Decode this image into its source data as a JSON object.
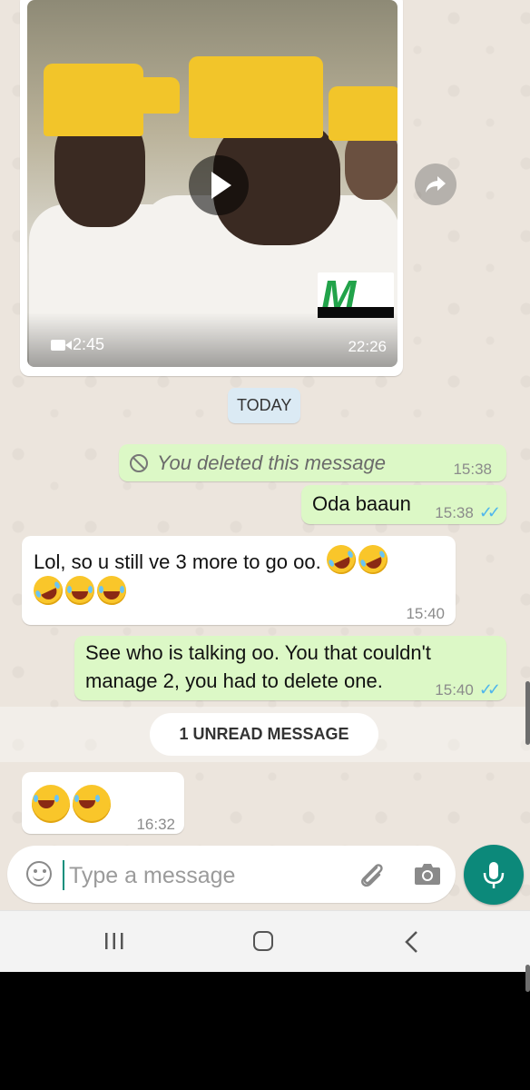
{
  "video_message": {
    "duration": "2:45",
    "time": "22:26",
    "overlay_logo": "M"
  },
  "date_divider": "TODAY",
  "messages": [
    {
      "direction": "outgoing",
      "text": "You deleted this message",
      "time": "15:38",
      "deleted": true
    },
    {
      "direction": "outgoing",
      "text": "Oda baaun",
      "time": "15:38",
      "status": "read"
    },
    {
      "direction": "incoming",
      "text": "Lol, so u still ve 3 more to go oo.",
      "emoji": [
        "rolling-laughing",
        "rolling-laughing",
        "rolling-laughing",
        "tears-of-joy",
        "tears-of-joy"
      ],
      "time": "15:40"
    },
    {
      "direction": "outgoing",
      "text": "See who is talking oo. You that couldn't manage 2, you had to delete one.",
      "time": "15:40",
      "status": "read"
    },
    {
      "direction": "incoming",
      "text": "",
      "emoji": [
        "tears-of-joy",
        "tears-of-joy"
      ],
      "time": "16:32"
    }
  ],
  "unread_banner": "1 UNREAD MESSAGE",
  "composer": {
    "placeholder": "Type a message",
    "value": ""
  },
  "colors": {
    "chat_background": "#ece5dd",
    "outgoing_bubble": "#dcf8c6",
    "incoming_bubble": "#ffffff",
    "date_chip": "#dbeaf4",
    "read_ticks": "#4fb6ec",
    "mic_button": "#0c897a"
  },
  "icons": [
    "play-icon",
    "video-camera-icon",
    "forward-icon",
    "blocked-icon",
    "double-check-icon",
    "emoji-icon",
    "attach-icon",
    "camera-icon",
    "mic-icon",
    "recent-apps-icon",
    "home-icon",
    "back-icon"
  ]
}
